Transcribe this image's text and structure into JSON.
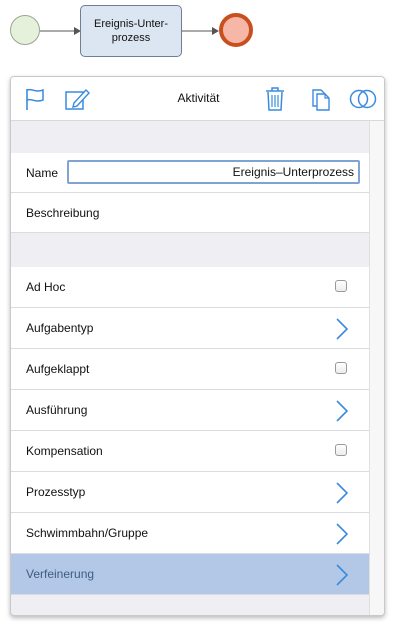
{
  "diagram": {
    "subprocess_label": "Ereignis-Unter-\nprozess"
  },
  "panel": {
    "title": "Aktivität",
    "toolbar_icons": [
      "flag-icon",
      "edit-icon",
      "trash-icon",
      "copy-icon",
      "overlap-circles-icon"
    ],
    "name": {
      "label": "Name",
      "value": "Ereignis–Unterprozess"
    },
    "description": {
      "label": "Beschreibung"
    },
    "properties": [
      {
        "label": "Ad Hoc",
        "control": "checkbox",
        "checked": false
      },
      {
        "label": "Aufgabentyp",
        "control": "chevron"
      },
      {
        "label": "Aufgeklappt",
        "control": "checkbox",
        "checked": false
      },
      {
        "label": "Ausführung",
        "control": "chevron"
      },
      {
        "label": "Kompensation",
        "control": "checkbox",
        "checked": false
      },
      {
        "label": "Prozesstyp",
        "control": "chevron"
      },
      {
        "label": "Schwimmbahn/Gruppe",
        "control": "chevron"
      },
      {
        "label": "Verfeinerung",
        "control": "chevron",
        "selected": true
      }
    ]
  },
  "colors": {
    "accent": "#3a8be0",
    "selection": "#b2c8e6",
    "end_event": "#c8501e"
  }
}
